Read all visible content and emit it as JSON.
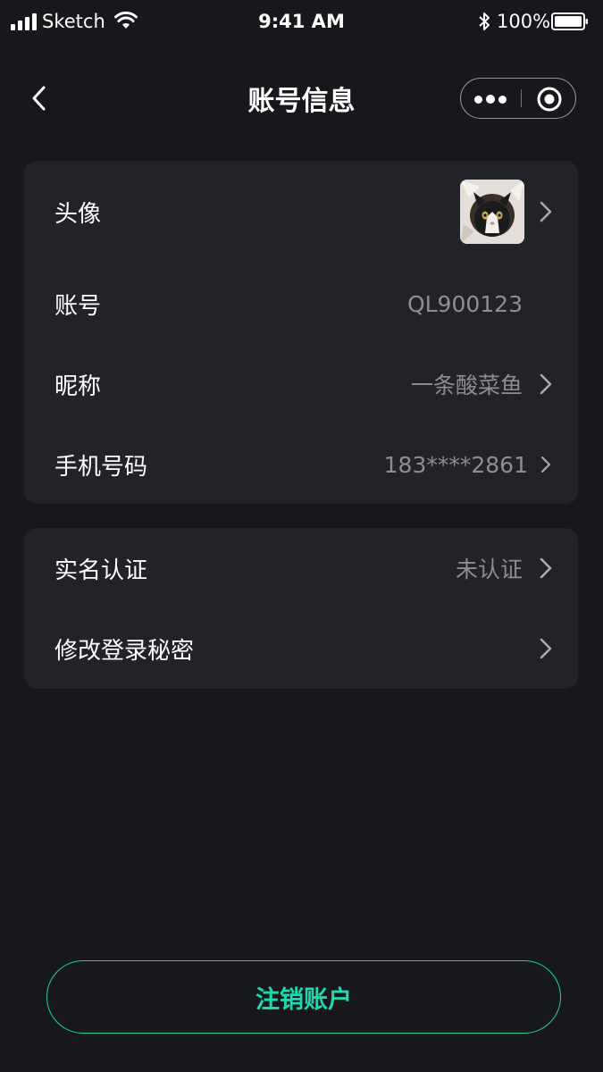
{
  "status_bar": {
    "carrier": "Sketch",
    "time": "9:41 AM",
    "battery": "100%"
  },
  "nav": {
    "title": "账号信息",
    "back_icon": "chevron-left-icon",
    "more_icon": "more-dots-icon",
    "close_icon": "target-close-icon"
  },
  "profile_card": {
    "rows": [
      {
        "label": "头像",
        "value": "",
        "type": "avatar",
        "chevron": true
      },
      {
        "label": "账号",
        "value": "QL900123",
        "chevron": false
      },
      {
        "label": "昵称",
        "value": "一条酸菜鱼",
        "chevron": true
      },
      {
        "label": "手机号码",
        "value": "183****2861",
        "chevron": true
      }
    ]
  },
  "security_card": {
    "rows": [
      {
        "label": "实名认证",
        "value": "未认证",
        "chevron": true
      },
      {
        "label": "修改登录秘密",
        "value": "",
        "chevron": true
      }
    ]
  },
  "actions": {
    "logout_label": "注销账户"
  },
  "colors": {
    "background": "#17181c",
    "card": "#222329",
    "accent": "#1fd8b0",
    "muted_text": "#8d8e92"
  }
}
